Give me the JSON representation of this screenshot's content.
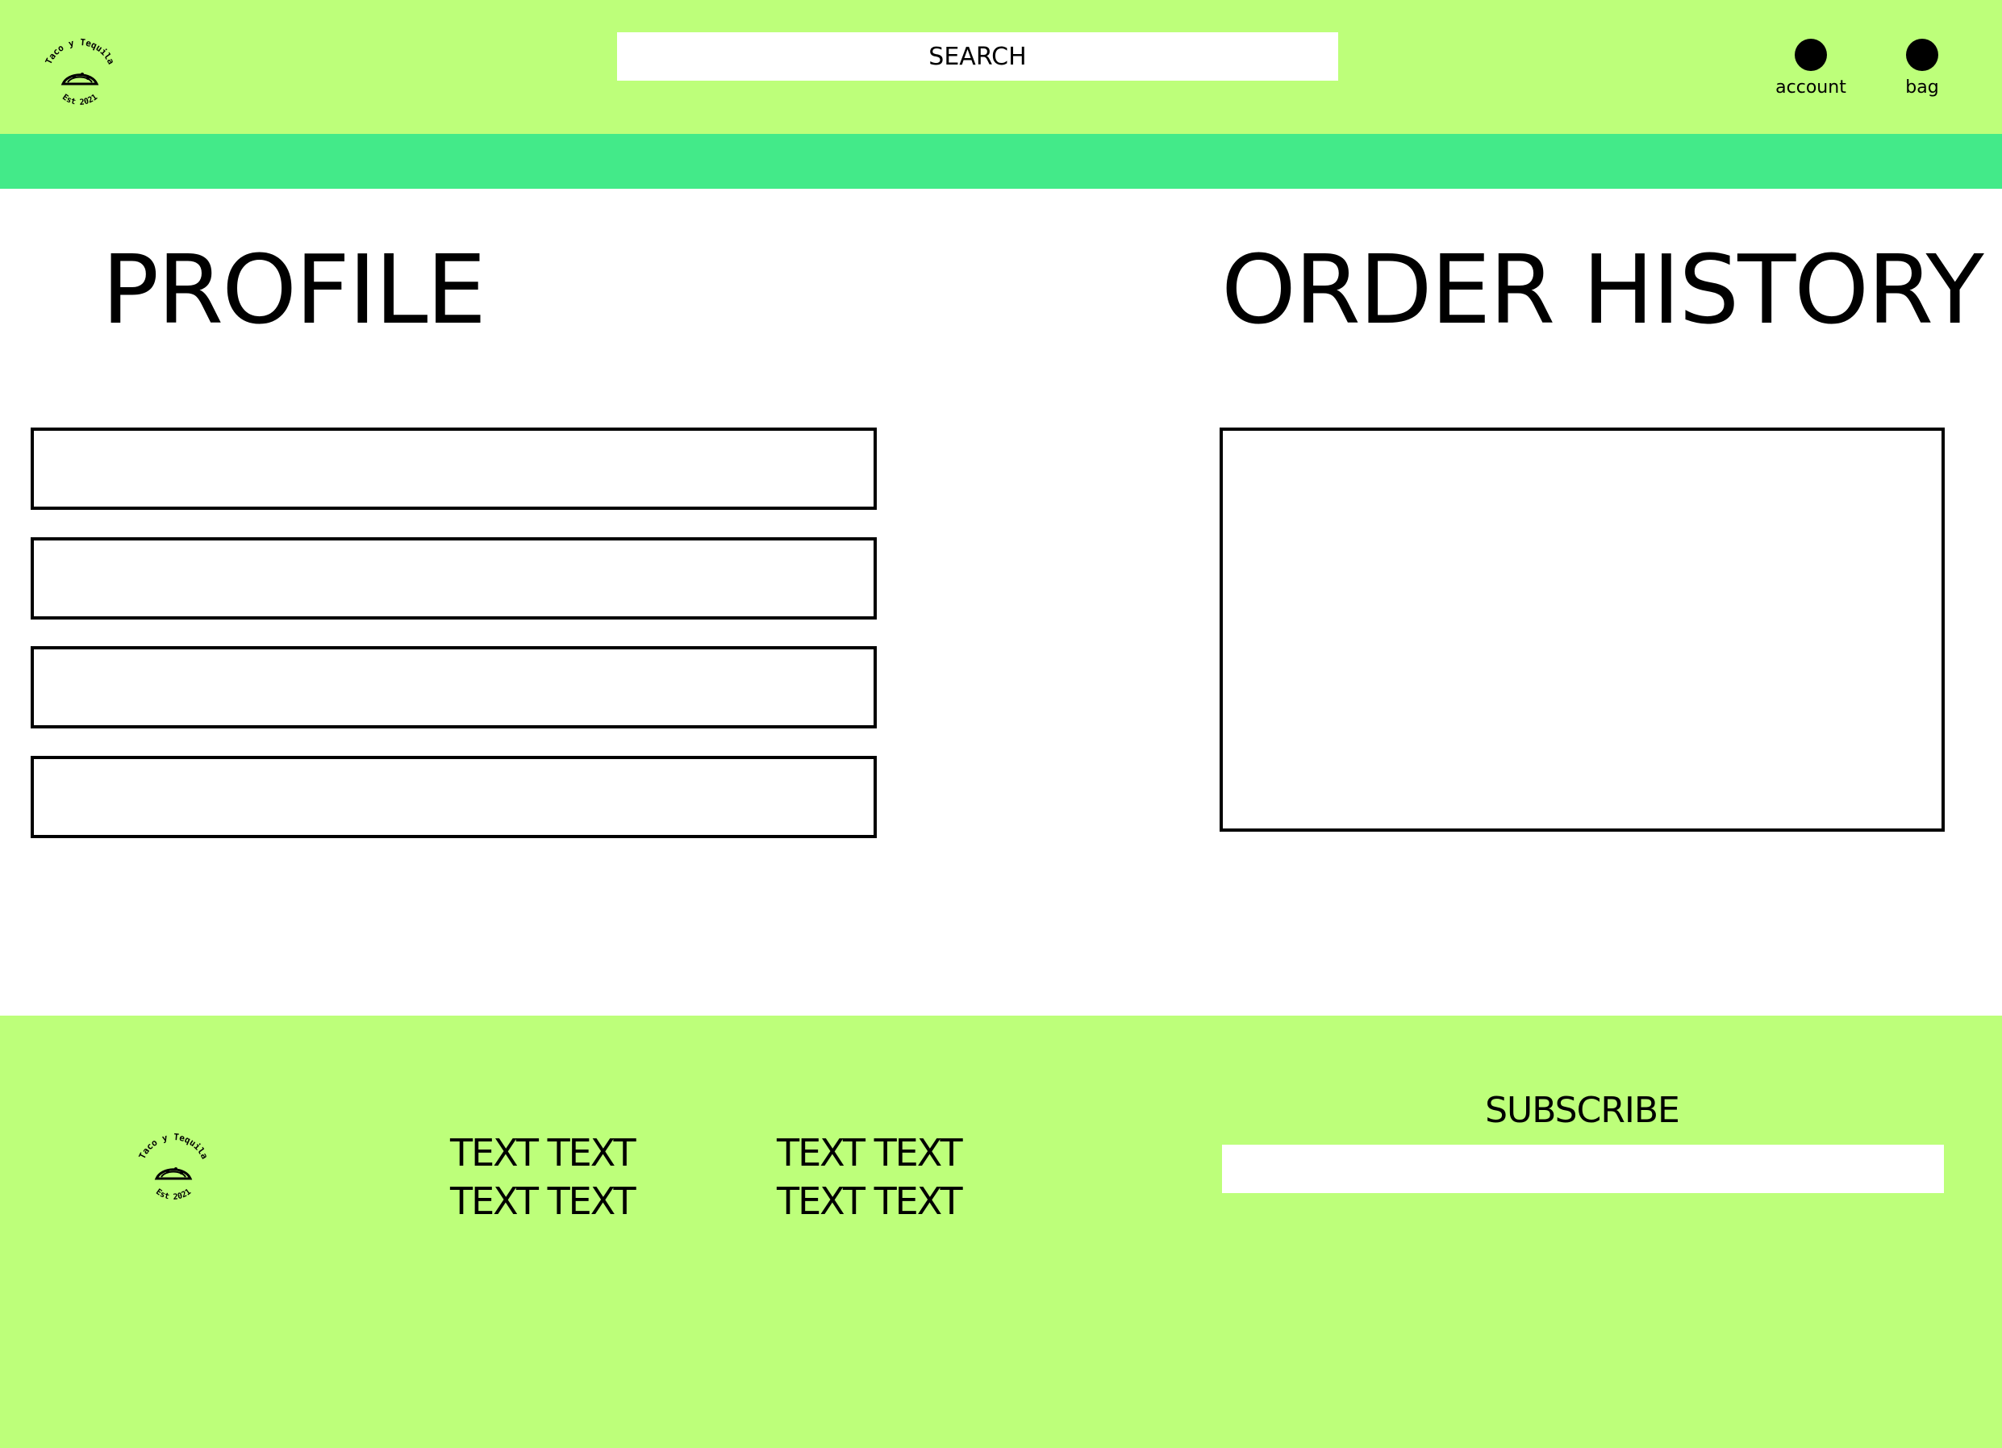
{
  "brand": {
    "logo_text_top": "Taco y Tequila",
    "logo_text_bottom": "Est 2021"
  },
  "header": {
    "search_label": "SEARCH",
    "account_label": "account",
    "bag_label": "bag"
  },
  "main": {
    "profile_title": "PROFILE",
    "order_history_title": "ORDER HISTORY"
  },
  "footer": {
    "link_columns": [
      [
        "TEXT TEXT",
        "TEXT TEXT"
      ],
      [
        "TEXT TEXT",
        "TEXT TEXT"
      ]
    ],
    "subscribe_label": "SUBSCRIBE"
  },
  "colors": {
    "header_bg": "#bdff7a",
    "stripe": "#43ea89",
    "footer_bg": "#bdff7a"
  },
  "icons": {
    "logo": "taco-icon",
    "account": "account-icon",
    "bag": "bag-icon"
  }
}
